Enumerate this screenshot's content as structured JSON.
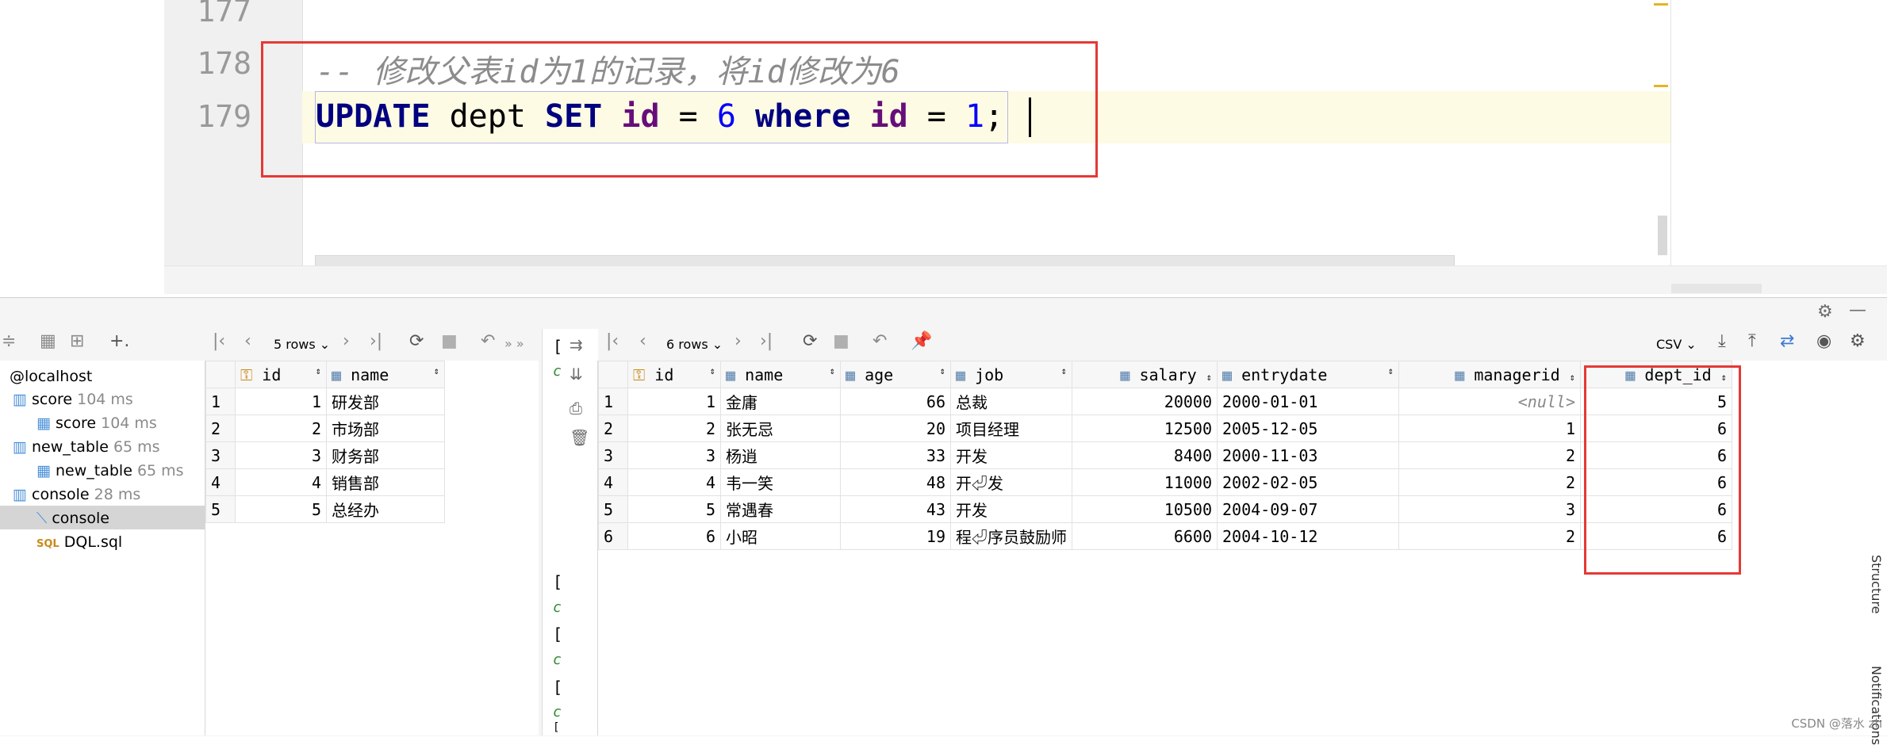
{
  "editor": {
    "lines": [
      {
        "num": "177"
      },
      {
        "num": "178",
        "comment": "-- 修改父表id为1的记录，将id修改为6"
      },
      {
        "num": "179"
      }
    ],
    "sql": {
      "kw_update": "UPDATE",
      "table": "dept",
      "kw_set": "SET",
      "col1": "id",
      "eq1": "=",
      "val1": "6",
      "kw_where": "where",
      "col2": "id",
      "eq2": "=",
      "val2": "1",
      "semi": ";"
    }
  },
  "tree": {
    "root": "@localhost",
    "items": [
      {
        "label": "score",
        "meta": "104 ms"
      },
      {
        "label": "score",
        "meta": "104 ms"
      },
      {
        "label": "new_table",
        "meta": "65 ms"
      },
      {
        "label": "new_table",
        "meta": "65 ms"
      },
      {
        "label": "console",
        "meta": "28 ms"
      },
      {
        "label": "console",
        "meta": ""
      },
      {
        "label": "DQL.sql",
        "meta": ""
      }
    ]
  },
  "grid1": {
    "rows_label": "5 rows",
    "headers": [
      "id",
      "name"
    ],
    "rows": [
      {
        "n": "1",
        "id": "1",
        "name": "研发部"
      },
      {
        "n": "2",
        "id": "2",
        "name": "市场部"
      },
      {
        "n": "3",
        "id": "3",
        "name": "财务部"
      },
      {
        "n": "4",
        "id": "4",
        "name": "销售部"
      },
      {
        "n": "5",
        "id": "5",
        "name": "总经办"
      }
    ]
  },
  "grid2": {
    "rows_label": "6 rows",
    "export_label": "CSV",
    "headers": [
      "id",
      "name",
      "age",
      "job",
      "salary",
      "entrydate",
      "managerid",
      "dept_id"
    ],
    "rows": [
      {
        "n": "1",
        "id": "1",
        "name": "金庸",
        "age": "66",
        "job": "总裁",
        "salary": "20000",
        "entrydate": "2000-01-01",
        "managerid": "<null>",
        "dept_id": "5"
      },
      {
        "n": "2",
        "id": "2",
        "name": "张无忌",
        "age": "20",
        "job": "项目经理",
        "salary": "12500",
        "entrydate": "2005-12-05",
        "managerid": "1",
        "dept_id": "6"
      },
      {
        "n": "3",
        "id": "3",
        "name": "杨逍",
        "age": "33",
        "job": "开发",
        "salary": "8400",
        "entrydate": "2000-11-03",
        "managerid": "2",
        "dept_id": "6"
      },
      {
        "n": "4",
        "id": "4",
        "name": "韦一笑",
        "age": "48",
        "job": "开⏎发",
        "salary": "11000",
        "entrydate": "2002-02-05",
        "managerid": "2",
        "dept_id": "6"
      },
      {
        "n": "5",
        "id": "5",
        "name": "常遇春",
        "age": "43",
        "job": "开发",
        "salary": "10500",
        "entrydate": "2004-09-07",
        "managerid": "3",
        "dept_id": "6"
      },
      {
        "n": "6",
        "id": "6",
        "name": "小昭",
        "age": "19",
        "job": "程⏎序员鼓励师",
        "salary": "6600",
        "entrydate": "2004-10-12",
        "managerid": "2",
        "dept_id": "6"
      }
    ]
  },
  "console_strip": [
    "[",
    "c",
    "[",
    "c",
    "[",
    "c",
    "[",
    "c",
    "["
  ],
  "side_labels": {
    "structure": "Structure",
    "notifications": "Notifications"
  },
  "watermark": "CSDN @落水 zh"
}
